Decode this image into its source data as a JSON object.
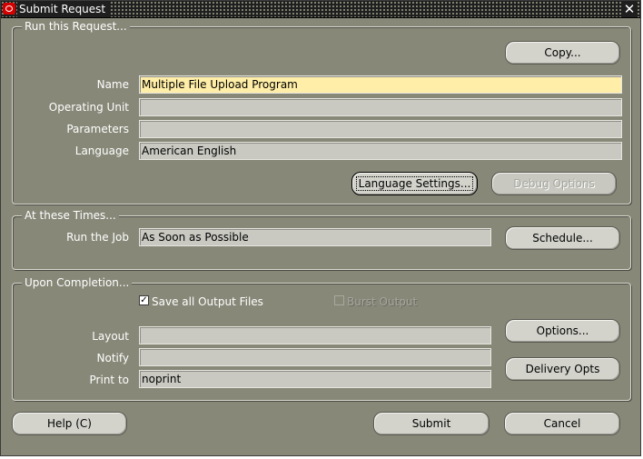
{
  "window": {
    "title": "Submit Request",
    "close_icon": "close-icon"
  },
  "run_request": {
    "group_title": "Run this Request...",
    "copy_button": "Copy...",
    "name_label": "Name",
    "name_value": "Multiple File Upload Program",
    "operating_unit_label": "Operating Unit",
    "operating_unit_value": "",
    "parameters_label": "Parameters",
    "parameters_value": "",
    "language_label": "Language",
    "language_value": "American English",
    "language_settings_button": "Language Settings...",
    "debug_options_button": "Debug Options"
  },
  "times": {
    "group_title": "At these Times...",
    "run_job_label": "Run the Job",
    "run_job_value": "As Soon as Possible",
    "schedule_button": "Schedule..."
  },
  "completion": {
    "group_title": "Upon Completion...",
    "save_output_label": "Save all Output Files",
    "save_output_checked": true,
    "burst_output_label": "Burst Output",
    "burst_output_checked": false,
    "layout_label": "Layout",
    "layout_value": "",
    "notify_label": "Notify",
    "notify_value": "",
    "print_to_label": "Print to",
    "print_to_value": "noprint",
    "options_button": "Options...",
    "delivery_opts_button": "Delivery Opts"
  },
  "footer": {
    "help_button": "Help (C)",
    "submit_button": "Submit",
    "cancel_button": "Cancel"
  },
  "colors": {
    "window_bg": "#878878",
    "field_bg": "#c9c9c2",
    "field_highlight": "#ffeea7",
    "button_bg": "#d3d3cc",
    "title_bar": "#1f1f1f"
  }
}
